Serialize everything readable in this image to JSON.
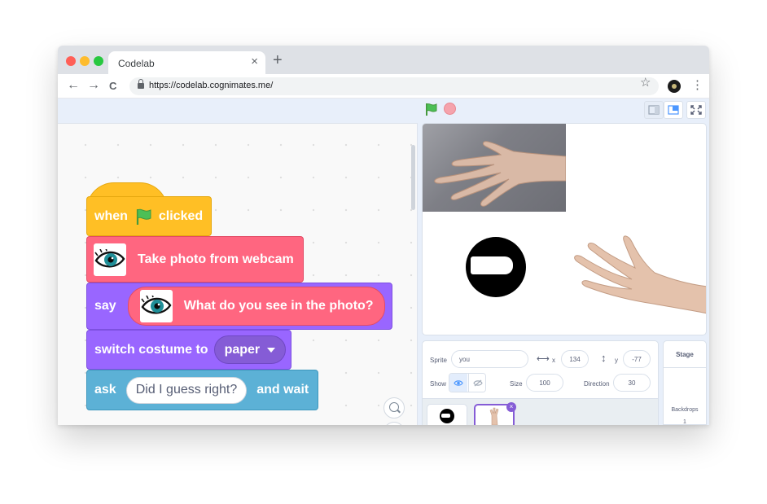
{
  "browser": {
    "tab_title": "Codelab",
    "tab_close": "×",
    "new_tab": "+",
    "back": "←",
    "forward": "→",
    "reload": "C",
    "url": "https://codelab.cognimates.me/",
    "bookmark": "☆",
    "menu": "⋮"
  },
  "colors": {
    "events": "#ffbf25",
    "extension": "#ff6680",
    "looks": "#9966ff",
    "sensing": "#5cb1d6",
    "flag_green": "#4cbf56"
  },
  "blocks": {
    "hat": {
      "when": "when",
      "clicked": "clicked",
      "icon": "green-flag-icon"
    },
    "photo": {
      "label": "Take photo from webcam",
      "icon": "eye-icon"
    },
    "say": {
      "label": "say",
      "reporter_label": "What do you see in the photo?"
    },
    "switch": {
      "label": "switch costume to",
      "value": "paper"
    },
    "ask": {
      "label": "ask",
      "input": "Did I guess right?",
      "suffix": "and wait"
    }
  },
  "sprite_info": {
    "sprite_label": "Sprite",
    "sprite_name": "you",
    "x_label": "x",
    "x_value": "134",
    "y_label": "y",
    "y_value": "-77",
    "show_label": "Show",
    "size_label": "Size",
    "size_value": "100",
    "direction_label": "Direction",
    "direction_value": "30",
    "delete_glyph": "×"
  },
  "stage_pane": {
    "title": "Stage",
    "backdrops_label": "Backdrops",
    "backdrops_count": "1"
  }
}
